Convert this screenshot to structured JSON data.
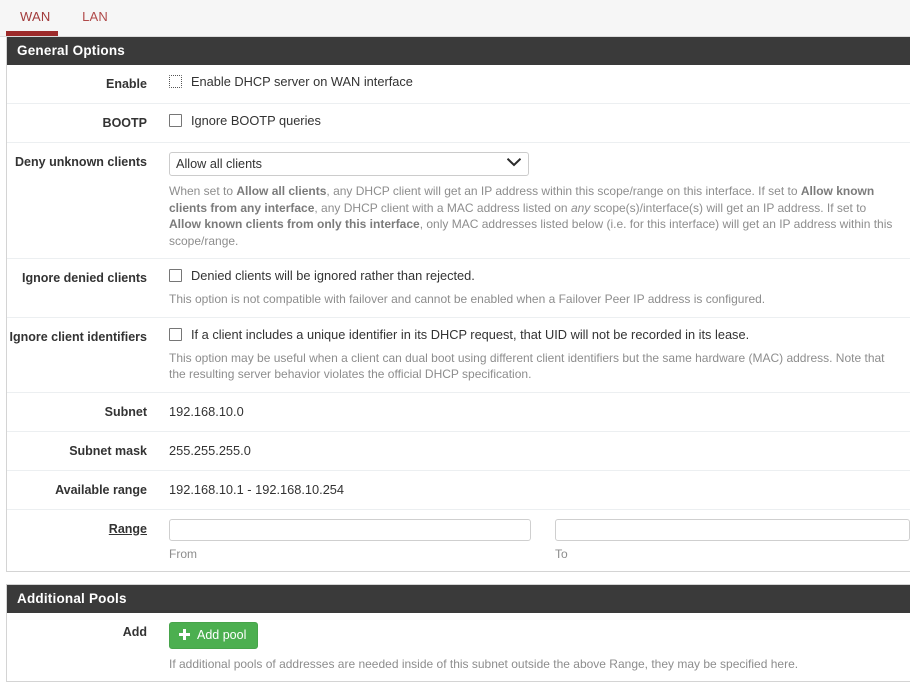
{
  "tabs": [
    {
      "label": "WAN",
      "active": true
    },
    {
      "label": "LAN",
      "active": false
    }
  ],
  "sections": {
    "general": {
      "title": "General Options",
      "enable": {
        "label": "Enable",
        "checkbox_text": "Enable DHCP server on WAN interface",
        "checked": false
      },
      "bootp": {
        "label": "BOOTP",
        "checkbox_text": "Ignore BOOTP queries",
        "checked": false
      },
      "deny_unknown": {
        "label": "Deny unknown clients",
        "selected": "Allow all clients",
        "options": [
          "Allow all clients",
          "Allow known clients from any interface",
          "Allow known clients from only this interface"
        ],
        "help_1": "When set to ",
        "help_b1": "Allow all clients",
        "help_2": ", any DHCP client will get an IP address within this scope/range on this interface. If set to ",
        "help_b2": "Allow known clients from any interface",
        "help_3": ", any DHCP client with a MAC address listed on ",
        "help_i1": "any",
        "help_4": " scope(s)/interface(s) will get an IP address. If set to ",
        "help_b3": "Allow known clients from only this interface",
        "help_5": ", only MAC addresses listed below (i.e. for this interface) will get an IP address within this scope/range."
      },
      "ignore_denied": {
        "label": "Ignore denied clients",
        "checkbox_text": "Denied clients will be ignored rather than rejected.",
        "checked": false,
        "help": "This option is not compatible with failover and cannot be enabled when a Failover Peer IP address is configured."
      },
      "ignore_client_ids": {
        "label": "Ignore client identifiers",
        "checkbox_text": "If a client includes a unique identifier in its DHCP request, that UID will not be recorded in its lease.",
        "checked": false,
        "help": "This option may be useful when a client can dual boot using different client identifiers but the same hardware (MAC) address. Note that the resulting server behavior violates the official DHCP specification."
      },
      "subnet": {
        "label": "Subnet",
        "value": "192.168.10.0"
      },
      "subnet_mask": {
        "label": "Subnet mask",
        "value": "255.255.255.0"
      },
      "available_range": {
        "label": "Available range",
        "value": "192.168.10.1 - 192.168.10.254"
      },
      "range": {
        "label": "Range",
        "from_value": "",
        "from_sublabel": "From",
        "to_value": "",
        "to_sublabel": "To"
      }
    },
    "additional_pools": {
      "title": "Additional Pools",
      "add": {
        "label": "Add",
        "button_label": "Add pool",
        "button_icon": "plus-icon",
        "help": "If additional pools of addresses are needed inside of this subnet outside the above Range, they may be specified here."
      }
    }
  },
  "colors": {
    "tab_red": "#b04a4a",
    "tab_underline": "#9d2b2b",
    "panel_heading_bg": "#3a3a3a",
    "button_green": "#4caf50",
    "help_text": "#8d8d8d"
  }
}
